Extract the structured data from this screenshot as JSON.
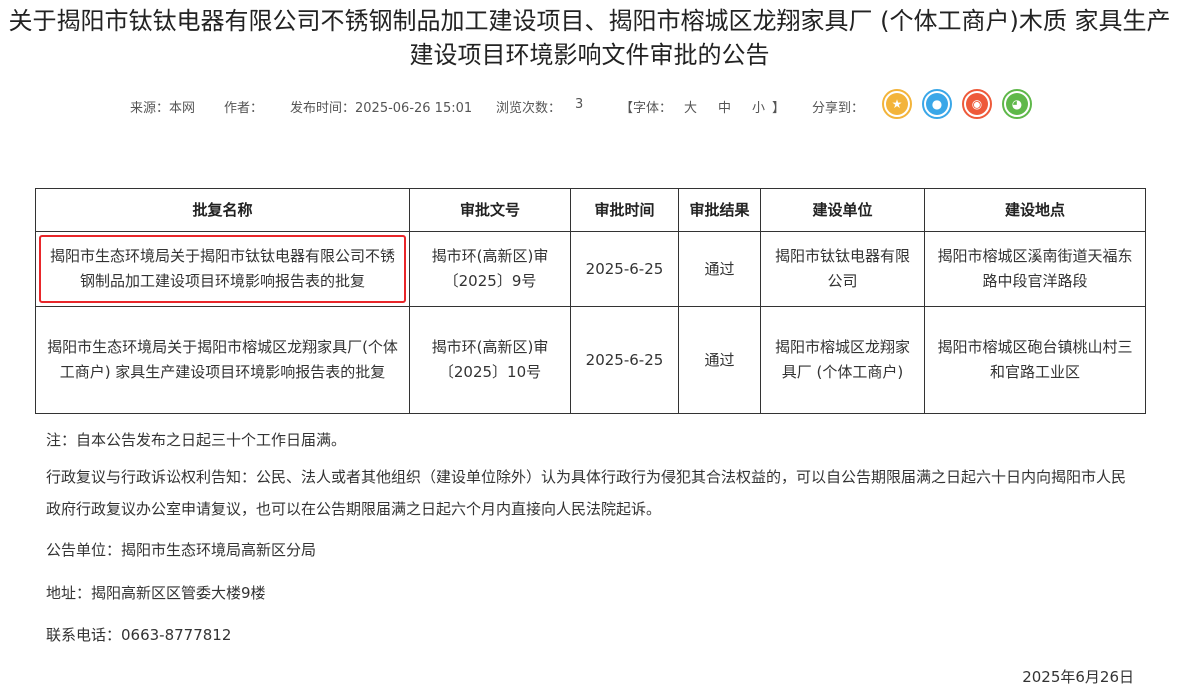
{
  "article": {
    "title_line1": "关于揭阳市钛钛电器有限公司不锈钢制品加工建设项目、揭阳市榕城区龙翔家具厂 (个体工商户)木质 家具生产",
    "title_line2": "建设项目环境影响文件审批的公告"
  },
  "meta": {
    "source": "来源：本网",
    "author": "作者：",
    "publish_time": "发布时间：2025-06-26 15:01",
    "views_label": "浏览次数：",
    "views_count": "3",
    "font_open": "【字体：",
    "font_large": "大",
    "font_medium": "中",
    "font_small": "小",
    "font_close": "】",
    "share_label": "分享到："
  },
  "share": {
    "icons": [
      {
        "name": "qzone-icon",
        "color": "#f3b43a",
        "glyph": "★"
      },
      {
        "name": "qq-icon",
        "color": "#3aa7e8",
        "glyph": "●"
      },
      {
        "name": "weibo-icon",
        "color": "#ee5a3a",
        "glyph": "◉"
      },
      {
        "name": "wechat-icon",
        "color": "#5fb84a",
        "glyph": "◕"
      }
    ]
  },
  "table": {
    "headers": [
      "批复名称",
      "审批文号",
      "审批时间",
      "审批结果",
      "建设单位",
      "建设地点"
    ],
    "rows": [
      {
        "name": "揭阳市生态环境局关于揭阳市钛钛电器有限公司不锈钢制品加工建设项目环境影响报告表的批复",
        "doc_no": "揭市环(高新区)审〔2025〕9号",
        "date": "2025-6-25",
        "result": "通过",
        "unit": "揭阳市钛钛电器有限公司",
        "location": "揭阳市榕城区溪南街道天福东路中段官洋路段"
      },
      {
        "name": "揭阳市生态环境局关于揭阳市榕城区龙翔家具厂(个体工商户) 家具生产建设项目环境影响报告表的批复",
        "doc_no": "揭市环(高新区)审〔2025〕10号",
        "date": "2025-6-25",
        "result": "通过",
        "unit": "揭阳市榕城区龙翔家具厂 (个体工商户)",
        "location": "揭阳市榕城区砲台镇桃山村三和官路工业区"
      }
    ]
  },
  "notes": {
    "note": "注：自本公告发布之日起三十个工作日届满。",
    "appeal": "行政复议与行政诉讼权利告知：公民、法人或者其他组织（建设单位除外）认为具体行政行为侵犯其合法权益的，可以自公告期限届满之日起六十日内向揭阳市人民政府行政复议办公室申请复议，也可以在公告期限届满之日起六个月内直接向人民法院起诉。",
    "issuer": "公告单位：揭阳市生态环境局高新区分局",
    "address": "地址：揭阳高新区区管委大楼9楼",
    "phone": "联系电话：0663-8777812",
    "date": "2025年6月26日"
  },
  "colors": {
    "highlight": "#e8262a",
    "border": "#333333"
  }
}
